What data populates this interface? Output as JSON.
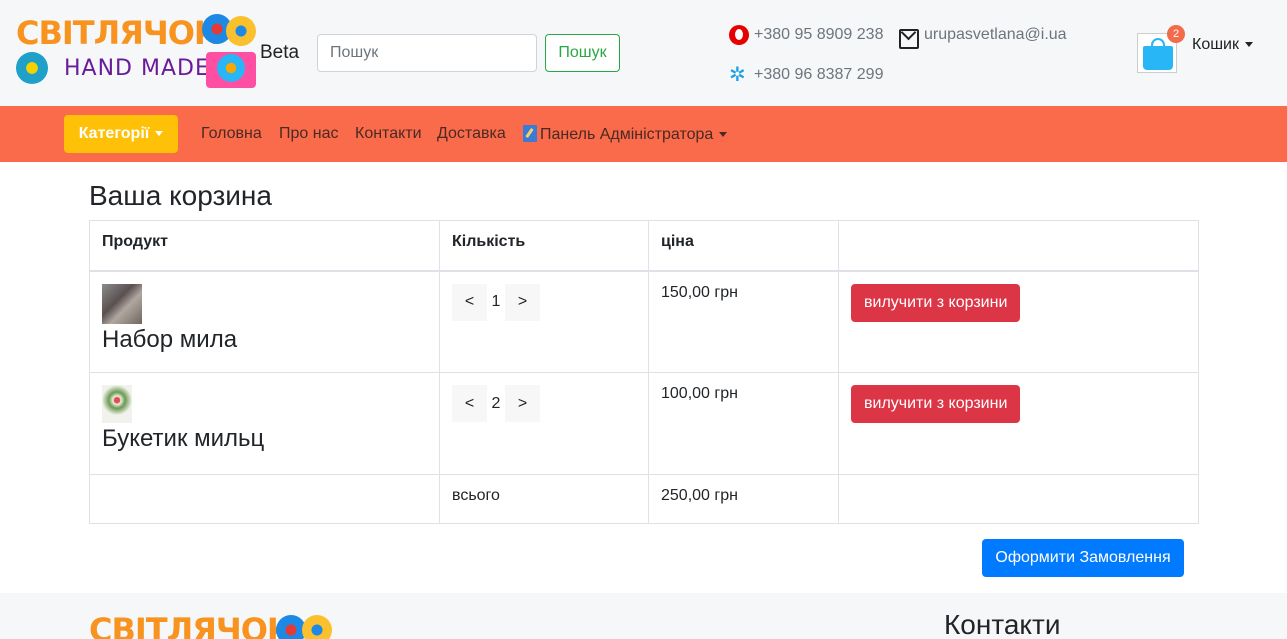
{
  "header": {
    "logo_text_top": "СВІТЛЯЧОК",
    "logo_text_bottom": "HAND MADE",
    "beta": "Beta",
    "search": {
      "placeholder": "Пошук",
      "button": "Пошук"
    },
    "phone_vodafone": "+380 95 8909 238",
    "phone_kyivstar": "+380 96 8387 299",
    "email": "urupasvetlana@i.ua",
    "cart_count": "2",
    "cart_label": "Кошик"
  },
  "nav": {
    "categories": "Категорії",
    "links": [
      "Головна",
      "Про нас",
      "Контакти",
      "Доставка"
    ],
    "admin": "Панель Адміністратора"
  },
  "cart": {
    "title": "Ваша корзина",
    "columns": [
      "Продукт",
      "Кількість",
      "ціна",
      ""
    ],
    "items": [
      {
        "name": "Набор мила",
        "qty": "1",
        "price": "150,00 грн",
        "remove": "вилучити з корзини"
      },
      {
        "name": "Букетик мильц",
        "qty": "2",
        "price": "100,00 грн",
        "remove": "вилучити з корзини"
      }
    ],
    "total_label": "всього",
    "total": "250,00 грн",
    "order_button": "Оформити Замовлення",
    "qty_dec": "<",
    "qty_inc": ">"
  },
  "footer": {
    "logo_text": "СВІТЛЯЧОК",
    "contacts_heading": "Контакти"
  },
  "colors": {
    "navbar": "#f96b4b",
    "categories_button": "#ffc107",
    "remove_button": "#dc3545",
    "order_button": "#007bff",
    "search_button": "#28a745",
    "cart_badge": "#f26b4a"
  }
}
